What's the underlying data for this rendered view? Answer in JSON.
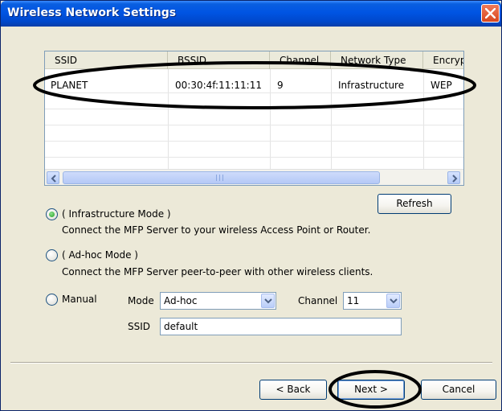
{
  "window": {
    "title": "Wireless Network Settings",
    "close_glyph": "×"
  },
  "network_table": {
    "columns": [
      "SSID",
      "BSSID",
      "Channel",
      "Network Type",
      "Encryption"
    ],
    "rows": [
      [
        "PLANET",
        "00:30:4f:11:11:11",
        "9",
        "Infrastructure",
        "WEP"
      ]
    ]
  },
  "refresh_label": "Refresh",
  "infrastructure": {
    "label": "( Infrastructure Mode )",
    "description": "Connect the MFP Server to your wireless Access Point or Router."
  },
  "adhoc": {
    "label": "( Ad-hoc Mode )",
    "description": "Connect the MFP Server peer-to-peer with other wireless clients."
  },
  "manual": {
    "label": "Manual",
    "mode_label": "Mode",
    "mode_value": "Ad-hoc",
    "channel_label": "Channel",
    "channel_value": "11",
    "ssid_label": "SSID",
    "ssid_value": "default"
  },
  "buttons": {
    "back": "< Back",
    "next": "Next >",
    "cancel": "Cancel"
  },
  "colors": {
    "titlebar": "#0054e3",
    "selected_radio": "#21a121",
    "annotation": "#000000"
  }
}
